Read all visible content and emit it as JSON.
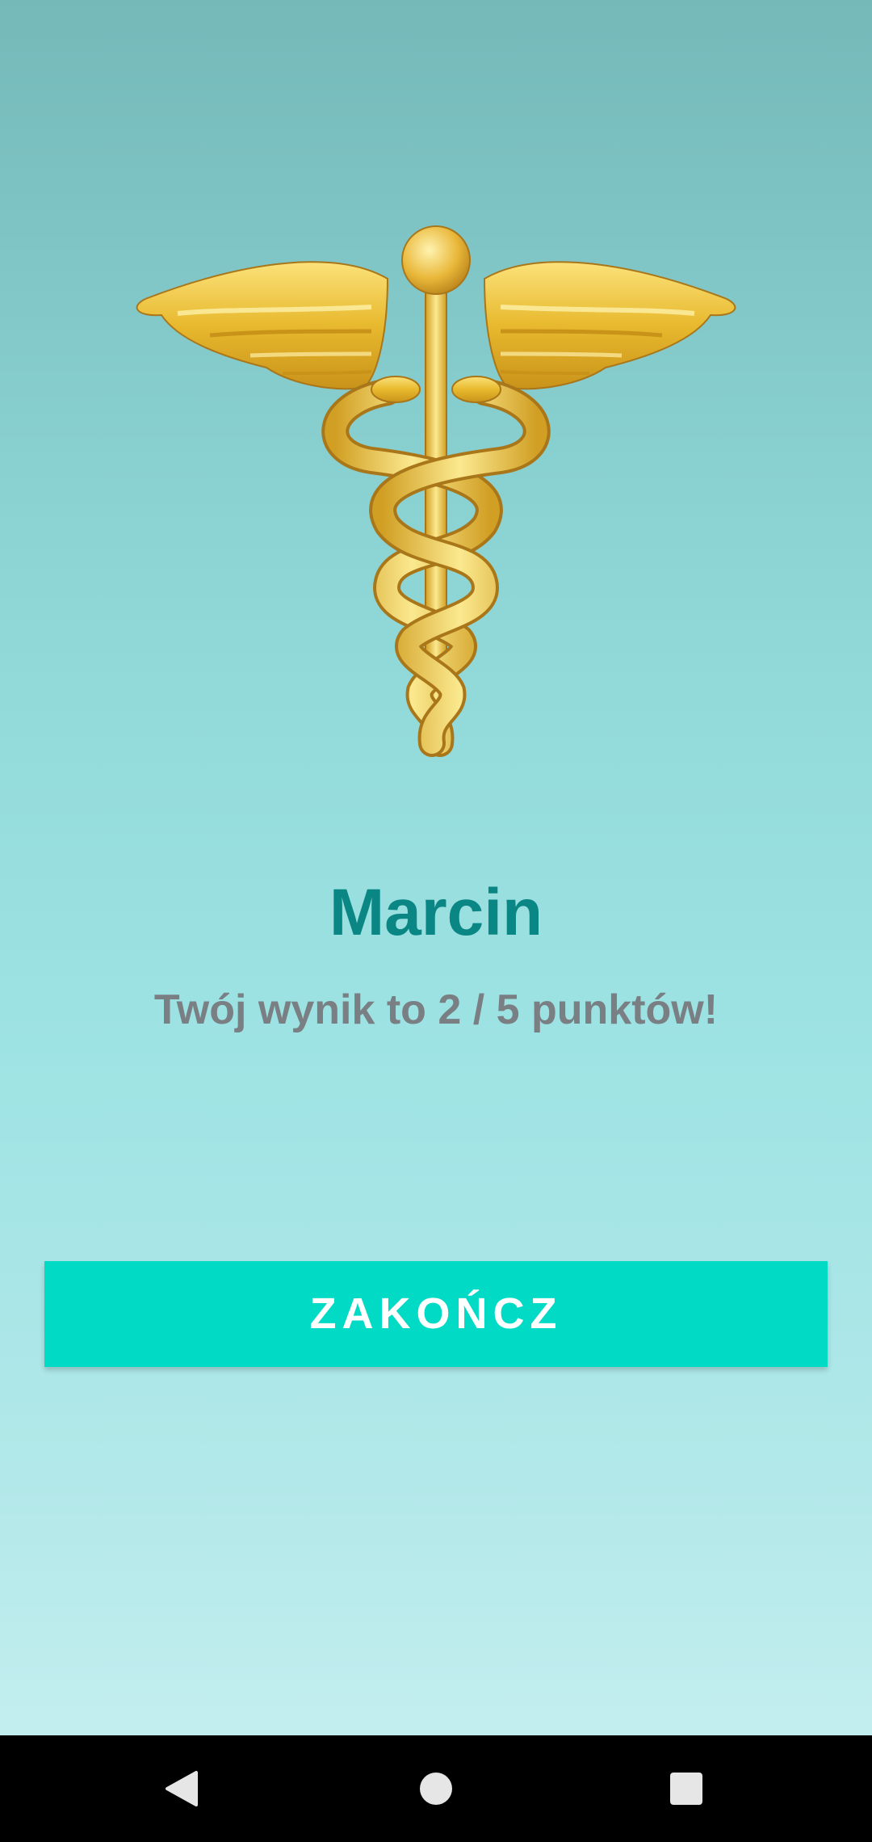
{
  "result": {
    "player_name": "Marcin",
    "score_message": "Twój wynik to 2 / 5 punktów!",
    "score": 2,
    "max_score": 5
  },
  "actions": {
    "finish_label": "ZAKOŃCZ"
  },
  "emblem": {
    "icon": "caduceus-icon",
    "color": "#e8b92e"
  },
  "navigation_bar": {
    "back_icon": "back-triangle-icon",
    "home_icon": "home-circle-icon",
    "recents_icon": "recents-square-icon"
  },
  "colors": {
    "name_color": "#0a8784",
    "score_color": "#7a7f84",
    "button_color": "#01dbc6"
  }
}
